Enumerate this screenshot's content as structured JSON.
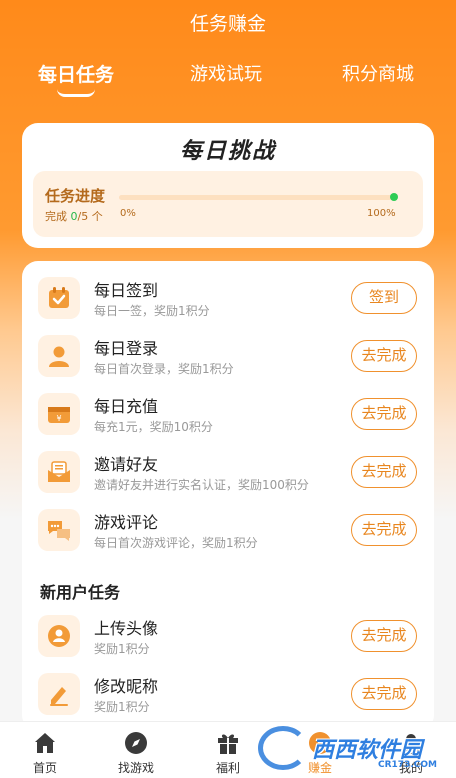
{
  "header": {
    "title": "任务赚金"
  },
  "tabs": [
    {
      "label": "每日任务",
      "active": true
    },
    {
      "label": "游戏试玩",
      "active": false
    },
    {
      "label": "积分商城",
      "active": false
    }
  ],
  "challenge": {
    "title": "每日挑战",
    "progress_label": "任务进度",
    "completed_prefix": "完成",
    "completed": "0",
    "total_suffix": "/5 个",
    "progress_fraction": 0.0,
    "min_label": "0%",
    "max_label": "100%"
  },
  "tasks": [
    {
      "icon": "calendar-check-icon",
      "title": "每日签到",
      "desc": "每日一签，奖励1积分",
      "button": "签到"
    },
    {
      "icon": "user-icon",
      "title": "每日登录",
      "desc": "每日首次登录，奖励1积分",
      "button": "去完成"
    },
    {
      "icon": "wallet-yen-icon",
      "title": "每日充值",
      "desc": "每充1元，奖励10积分",
      "button": "去完成"
    },
    {
      "icon": "envelope-icon",
      "title": "邀请好友",
      "desc": "邀请好友并进行实名认证，奖励100积分",
      "button": "去完成"
    },
    {
      "icon": "comment-icon",
      "title": "游戏评论",
      "desc": "每日首次游戏评论，奖励1积分",
      "button": "去完成"
    }
  ],
  "new_user_section": {
    "title": "新用户任务"
  },
  "new_user_tasks": [
    {
      "icon": "avatar-icon",
      "title": "上传头像",
      "desc": "奖励1积分",
      "button": "去完成"
    },
    {
      "icon": "pencil-icon",
      "title": "修改昵称",
      "desc": "奖励1积分",
      "button": "去完成"
    }
  ],
  "bottom_nav": [
    {
      "label": "首页",
      "icon": "home-icon",
      "active": false
    },
    {
      "label": "找游戏",
      "icon": "compass-icon",
      "active": false
    },
    {
      "label": "福利",
      "icon": "gift-icon",
      "active": false
    },
    {
      "label": "赚金",
      "icon": "coin-icon",
      "active": true
    },
    {
      "label": "我的",
      "icon": "profile-icon",
      "active": false
    }
  ],
  "watermark": {
    "text": "西西软件园",
    "sub": "CR173.COM"
  },
  "colors": {
    "accent": "#f0912e",
    "header_orange": "#ff8a1a",
    "progress_dot": "#2ecc55"
  }
}
